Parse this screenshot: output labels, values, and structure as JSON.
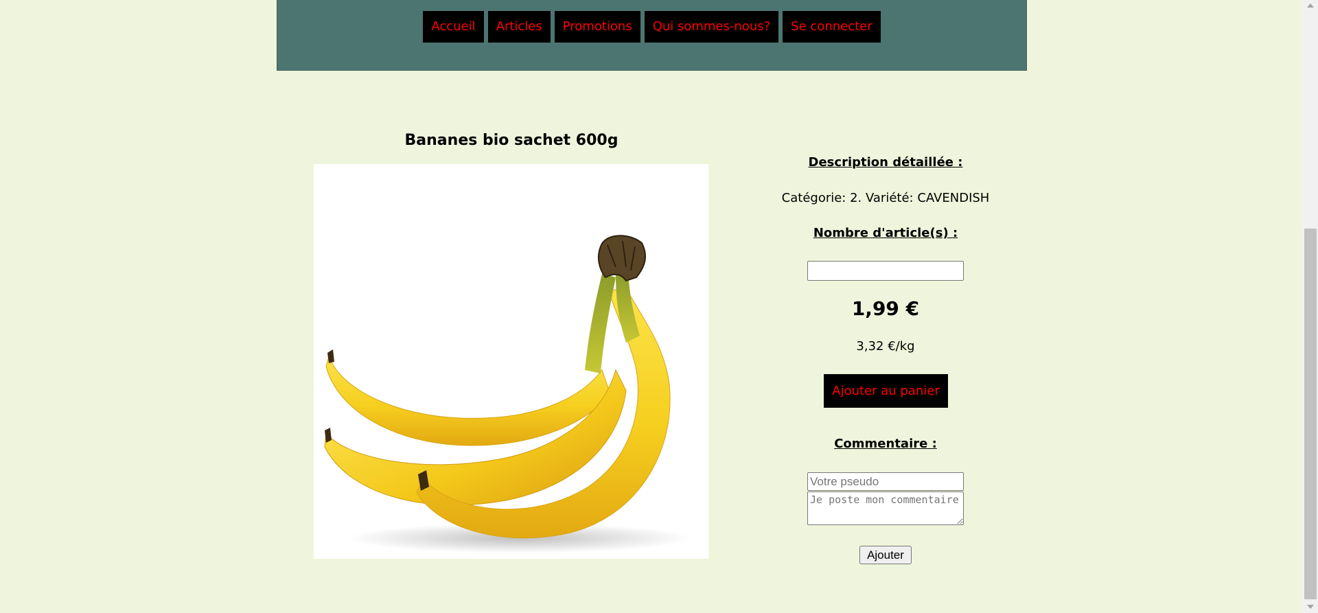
{
  "nav": {
    "items": [
      {
        "label": "Accueil"
      },
      {
        "label": "Articles"
      },
      {
        "label": "Promotions"
      },
      {
        "label": "Qui sommes-nous?"
      },
      {
        "label": "Se connecter"
      }
    ]
  },
  "product": {
    "title": "Bananes bio sachet 600g",
    "image_icon": "banana-bunch-image"
  },
  "details": {
    "description_label": "Description détaillée :",
    "description_text": "Catégorie: 2. Variété: CAVENDISH",
    "quantity_label": "Nombre d'article(s) :",
    "quantity_value": "",
    "price": "1,99 €",
    "unit_price": "3,32 €/kg",
    "add_to_cart_label": "Ajouter au panier"
  },
  "comments": {
    "label": "Commentaire :",
    "pseudo_placeholder": "Votre pseudo",
    "comment_placeholder": "Je poste mon commentaire",
    "submit_label": "Ajouter"
  },
  "colors": {
    "page_background": "#eff5dc",
    "header_background": "#4c7571",
    "button_background": "#000000",
    "button_text": "#ff0000"
  }
}
